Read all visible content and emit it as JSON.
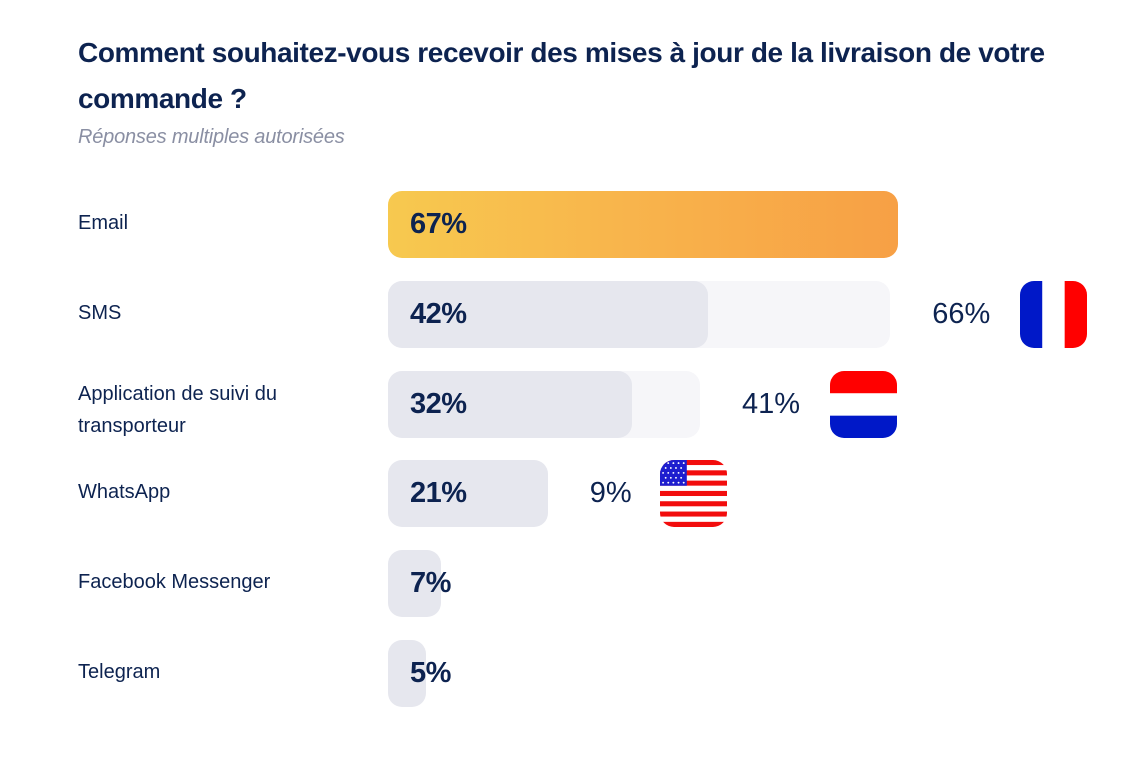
{
  "header": {
    "title": "Comment souhaitez-vous recevoir des mises à jour de la livraison de votre commande ?",
    "subtitle": "Réponses multiples autorisées"
  },
  "colors": {
    "text": "#0d2350",
    "bar": "#e6e7ee",
    "bar_compare": "#f6f6f9",
    "highlight_start": "#f7c94f",
    "highlight_end": "#f7a045"
  },
  "chart_data": {
    "type": "bar",
    "orientation": "horizontal",
    "title": "Comment souhaitez-vous recevoir des mises à jour de la livraison de votre commande ?",
    "subtitle": "Réponses multiples autorisées",
    "xlabel": "",
    "ylabel": "",
    "unit": "%",
    "xlim": [
      0,
      100
    ],
    "grid": false,
    "categories": [
      "Email",
      "SMS",
      "Application de suivi du transporteur",
      "WhatsApp",
      "Facebook Messenger",
      "Telegram"
    ],
    "values": [
      67,
      42,
      32,
      21,
      7,
      5
    ],
    "value_labels": [
      "67%",
      "42%",
      "32%",
      "21%",
      "7%",
      "5%"
    ],
    "highlighted_category": "Email",
    "comparisons": [
      {
        "category": "SMS",
        "country": "France",
        "flag": "france-flag-icon",
        "value": 66,
        "label": "66%"
      },
      {
        "category": "Application de suivi du transporteur",
        "country": "Pays-Bas",
        "flag": "netherlands-flag-icon",
        "value": 41,
        "label": "41%"
      },
      {
        "category": "WhatsApp",
        "country": "États-Unis",
        "flag": "usa-flag-icon",
        "value": 9,
        "label": "9%"
      }
    ]
  }
}
